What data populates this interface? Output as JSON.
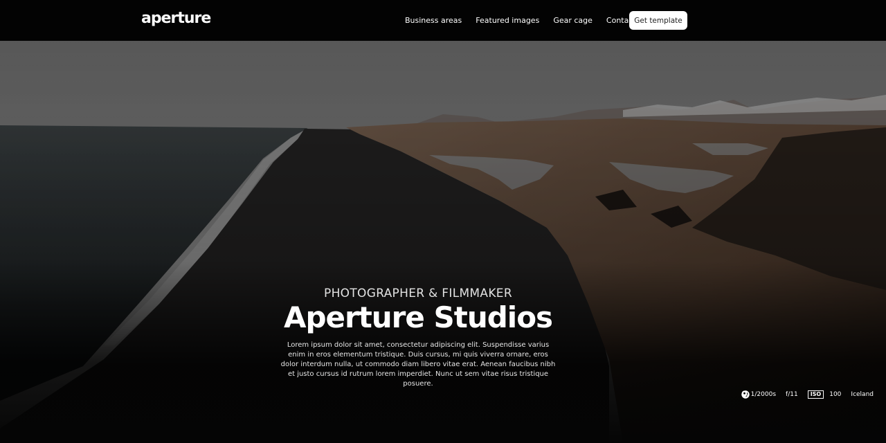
{
  "nav": {
    "logo": "aperture",
    "links": [
      "Business areas",
      "Featured images",
      "Gear cage",
      "Contact"
    ],
    "cta": "Get template"
  },
  "hero": {
    "eyebrow": "PHOTOGRAPHER & FILMMAKER",
    "title": "Aperture Studios",
    "description": "Lorem ipsum dolor sit amet, consectetur adipiscing elit. Suspendisse varius enim in eros elementum tristique. Duis cursus, mi quis viverra ornare, eros dolor interdum nulla, ut commodo diam libero vitae erat. Aenean faucibus nibh et justo cursus id rutrum lorem imperdiet. Nunc ut sem vitae risus tristique posuere."
  },
  "camera_meta": {
    "shutter": "1/2000s",
    "aperture": "f/11",
    "iso_label": "ISO",
    "iso": "100",
    "location": "Iceland",
    "icons": [
      "shutter-icon",
      "aperture-icon",
      "iso-icon",
      "location-pin-icon"
    ]
  }
}
